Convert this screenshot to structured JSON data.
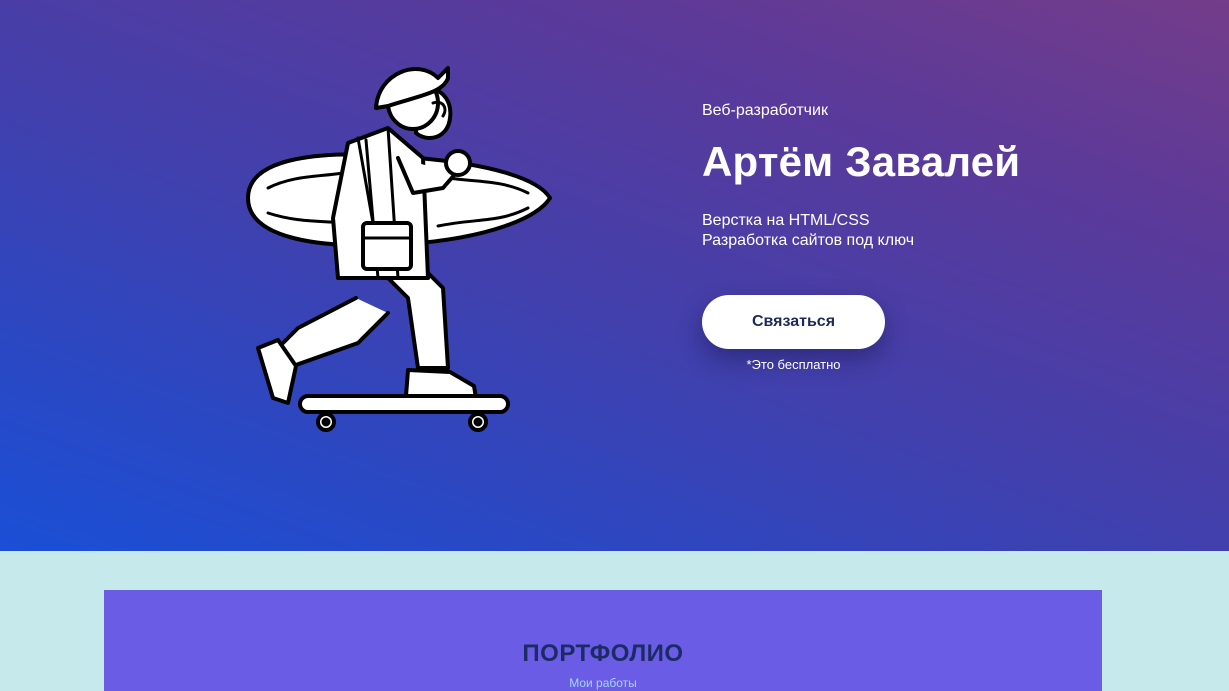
{
  "hero": {
    "role": "Веб-разработчик",
    "name": "Артём Завалей",
    "services": [
      "Верстка на HTML/CSS",
      "Разработка сайтов под ключ"
    ],
    "contact_button": "Связаться",
    "free_note": "*Это бесплатно",
    "illustration": "skateboarder-with-surfboard-illustration"
  },
  "portfolio": {
    "title": "ПОРТФОЛИО",
    "subtitle": "Мои работы"
  },
  "colors": {
    "hero_gradient_start": "#1a4fd6",
    "hero_gradient_end": "#743c8a",
    "page_background": "#c6e9eb",
    "portfolio_background": "#6b5ce6",
    "button_text": "#1e2b58",
    "portfolio_title": "#1c2a66"
  }
}
